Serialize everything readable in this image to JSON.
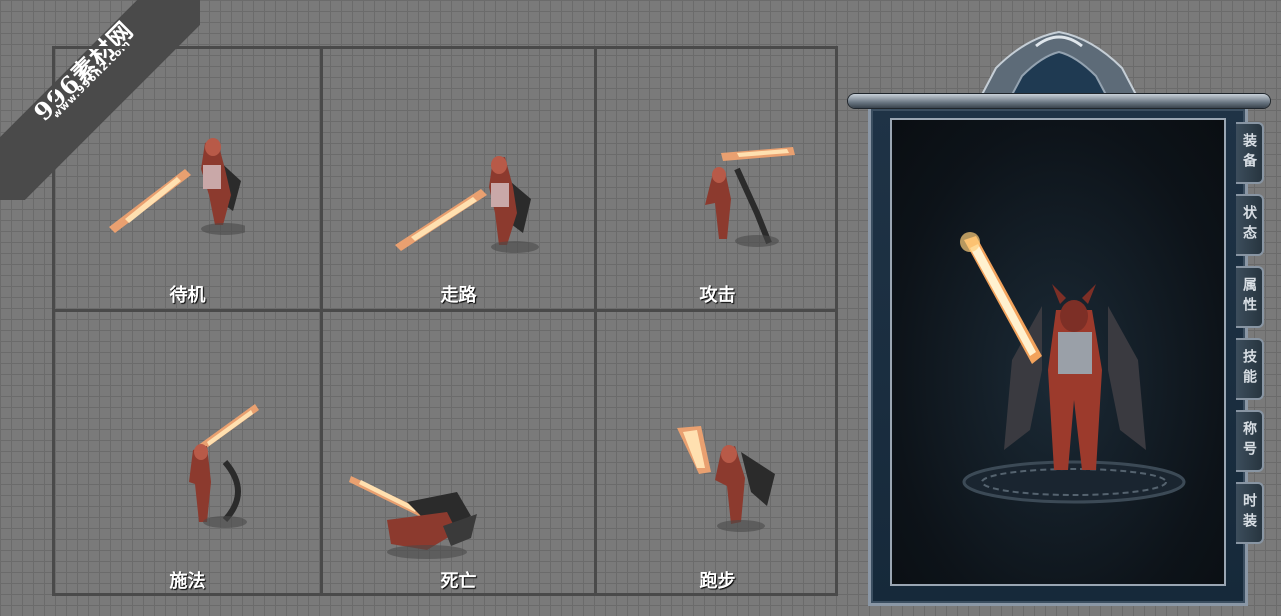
{
  "watermark": {
    "brand": "996素材网",
    "url": "www.996n2.com"
  },
  "animations": [
    {
      "label": "待机"
    },
    {
      "label": "走路"
    },
    {
      "label": "攻击"
    },
    {
      "label": "施法"
    },
    {
      "label": "死亡"
    },
    {
      "label": "跑步"
    }
  ],
  "side_tabs": [
    "装备",
    "状态",
    "属性",
    "技能",
    "称号",
    "时装"
  ]
}
